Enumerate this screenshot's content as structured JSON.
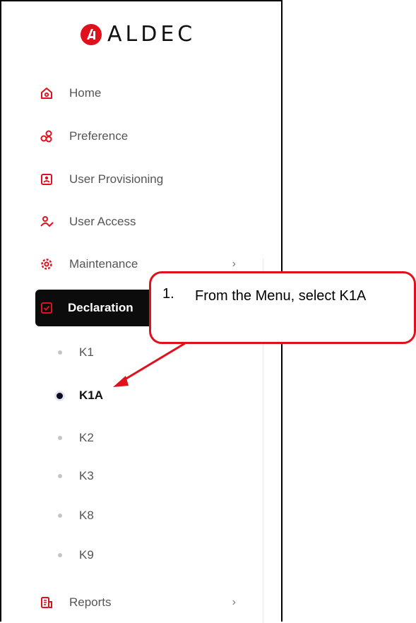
{
  "logo": {
    "name": "ALDEC"
  },
  "menu": {
    "home": {
      "label": "Home",
      "icon": "home-icon"
    },
    "preference": {
      "label": "Preference",
      "icon": "preference-icon"
    },
    "user_provisioning": {
      "label": "User Provisioning",
      "icon": "user-provisioning-icon"
    },
    "user_access": {
      "label": "User Access",
      "icon": "user-access-icon"
    },
    "maintenance": {
      "label": "Maintenance",
      "icon": "gear-icon",
      "chevron": "›"
    },
    "declaration": {
      "label": "Declaration",
      "icon": "declaration-icon"
    },
    "reports": {
      "label": "Reports",
      "icon": "reports-icon",
      "chevron": "›"
    }
  },
  "submenu": {
    "items": [
      "K1",
      "K1A",
      "K2",
      "K3",
      "K8",
      "K9"
    ],
    "selected": "K1A"
  },
  "callout": {
    "number": "1.",
    "text": "From the Menu, select K1A"
  },
  "colors": {
    "accent": "#e0101d",
    "active_bg": "#0c0c0c",
    "text": "#555555"
  }
}
